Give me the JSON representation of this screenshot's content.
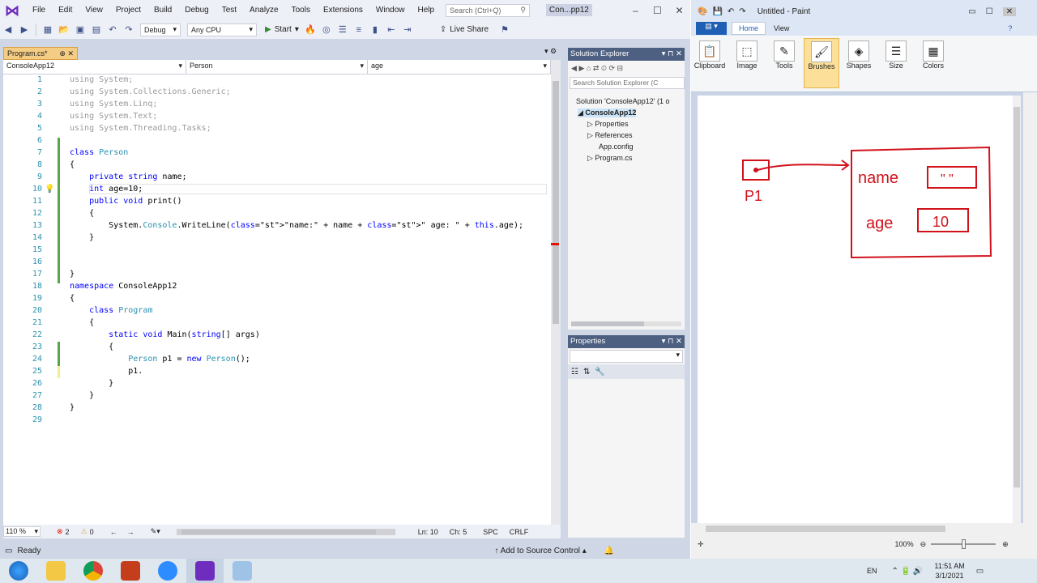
{
  "vs": {
    "menu": [
      "File",
      "Edit",
      "View",
      "Project",
      "Build",
      "Debug",
      "Test",
      "Analyze",
      "Tools",
      "Extensions",
      "Window",
      "Help"
    ],
    "search_placeholder": "Search (Ctrl+Q)",
    "window_title": "Con...pp12",
    "toolbar": {
      "config": "Debug",
      "platform": "Any CPU",
      "start": "Start",
      "live_share": "Live Share"
    },
    "doc_tab": "Program.cs*",
    "nav": {
      "project": "ConsoleApp12",
      "class": "Person",
      "member": "age"
    },
    "code_lines": [
      {
        "n": "1",
        "text": "using System;"
      },
      {
        "n": "2",
        "text": "using System.Collections.Generic;"
      },
      {
        "n": "3",
        "text": "using System.Linq;"
      },
      {
        "n": "4",
        "text": "using System.Text;"
      },
      {
        "n": "5",
        "text": "using System.Threading.Tasks;"
      },
      {
        "n": "6",
        "text": ""
      },
      {
        "n": "7",
        "text": "class Person"
      },
      {
        "n": "8",
        "text": "{"
      },
      {
        "n": "9",
        "text": "    private string name;"
      },
      {
        "n": "10",
        "text": "    int age=10;"
      },
      {
        "n": "11",
        "text": "    public void print()"
      },
      {
        "n": "12",
        "text": "    {"
      },
      {
        "n": "13",
        "text": "        System.Console.WriteLine(\"name:\" + name + \" age: \" + this.age);"
      },
      {
        "n": "14",
        "text": "    }"
      },
      {
        "n": "15",
        "text": ""
      },
      {
        "n": "16",
        "text": ""
      },
      {
        "n": "17",
        "text": "}"
      },
      {
        "n": "18",
        "text": "namespace ConsoleApp12"
      },
      {
        "n": "19",
        "text": "{"
      },
      {
        "n": "20",
        "text": "    class Program"
      },
      {
        "n": "21",
        "text": "    {"
      },
      {
        "n": "22",
        "text": "        static void Main(string[] args)"
      },
      {
        "n": "23",
        "text": "        {"
      },
      {
        "n": "24",
        "text": "            Person p1 = new Person();"
      },
      {
        "n": "25",
        "text": "            p1."
      },
      {
        "n": "26",
        "text": "        }"
      },
      {
        "n": "27",
        "text": "    }"
      },
      {
        "n": "28",
        "text": "}"
      },
      {
        "n": "29",
        "text": ""
      }
    ],
    "hbar": {
      "zoom": "110 %",
      "errors": "2",
      "warnings": "0",
      "ln": "Ln: 10",
      "ch": "Ch: 5",
      "spc": "SPC",
      "crlf": "CRLF"
    },
    "status": {
      "ready": "Ready",
      "source_control": "Add to Source Control"
    },
    "solution_explorer": {
      "title": "Solution Explorer",
      "search": "Search Solution Explorer (C",
      "items": [
        "Solution 'ConsoleApp12' (1 o",
        "ConsoleApp12",
        "Properties",
        "References",
        "App.config",
        "Program.cs"
      ]
    },
    "properties_title": "Properties"
  },
  "paint": {
    "title": "Untitled - Paint",
    "tabs": [
      "Home",
      "View"
    ],
    "ribbon": [
      "Clipboard",
      "Image",
      "Tools",
      "Brushes",
      "Shapes",
      "Size",
      "Colors"
    ],
    "zoom": "100%",
    "drawing": {
      "p1": "P1",
      "name": "name",
      "name_value": "\" \"",
      "age": "age",
      "age_value": "10"
    }
  },
  "taskbar": {
    "lang": "EN",
    "time": "11:51 AM",
    "date": "3/1/2021"
  }
}
